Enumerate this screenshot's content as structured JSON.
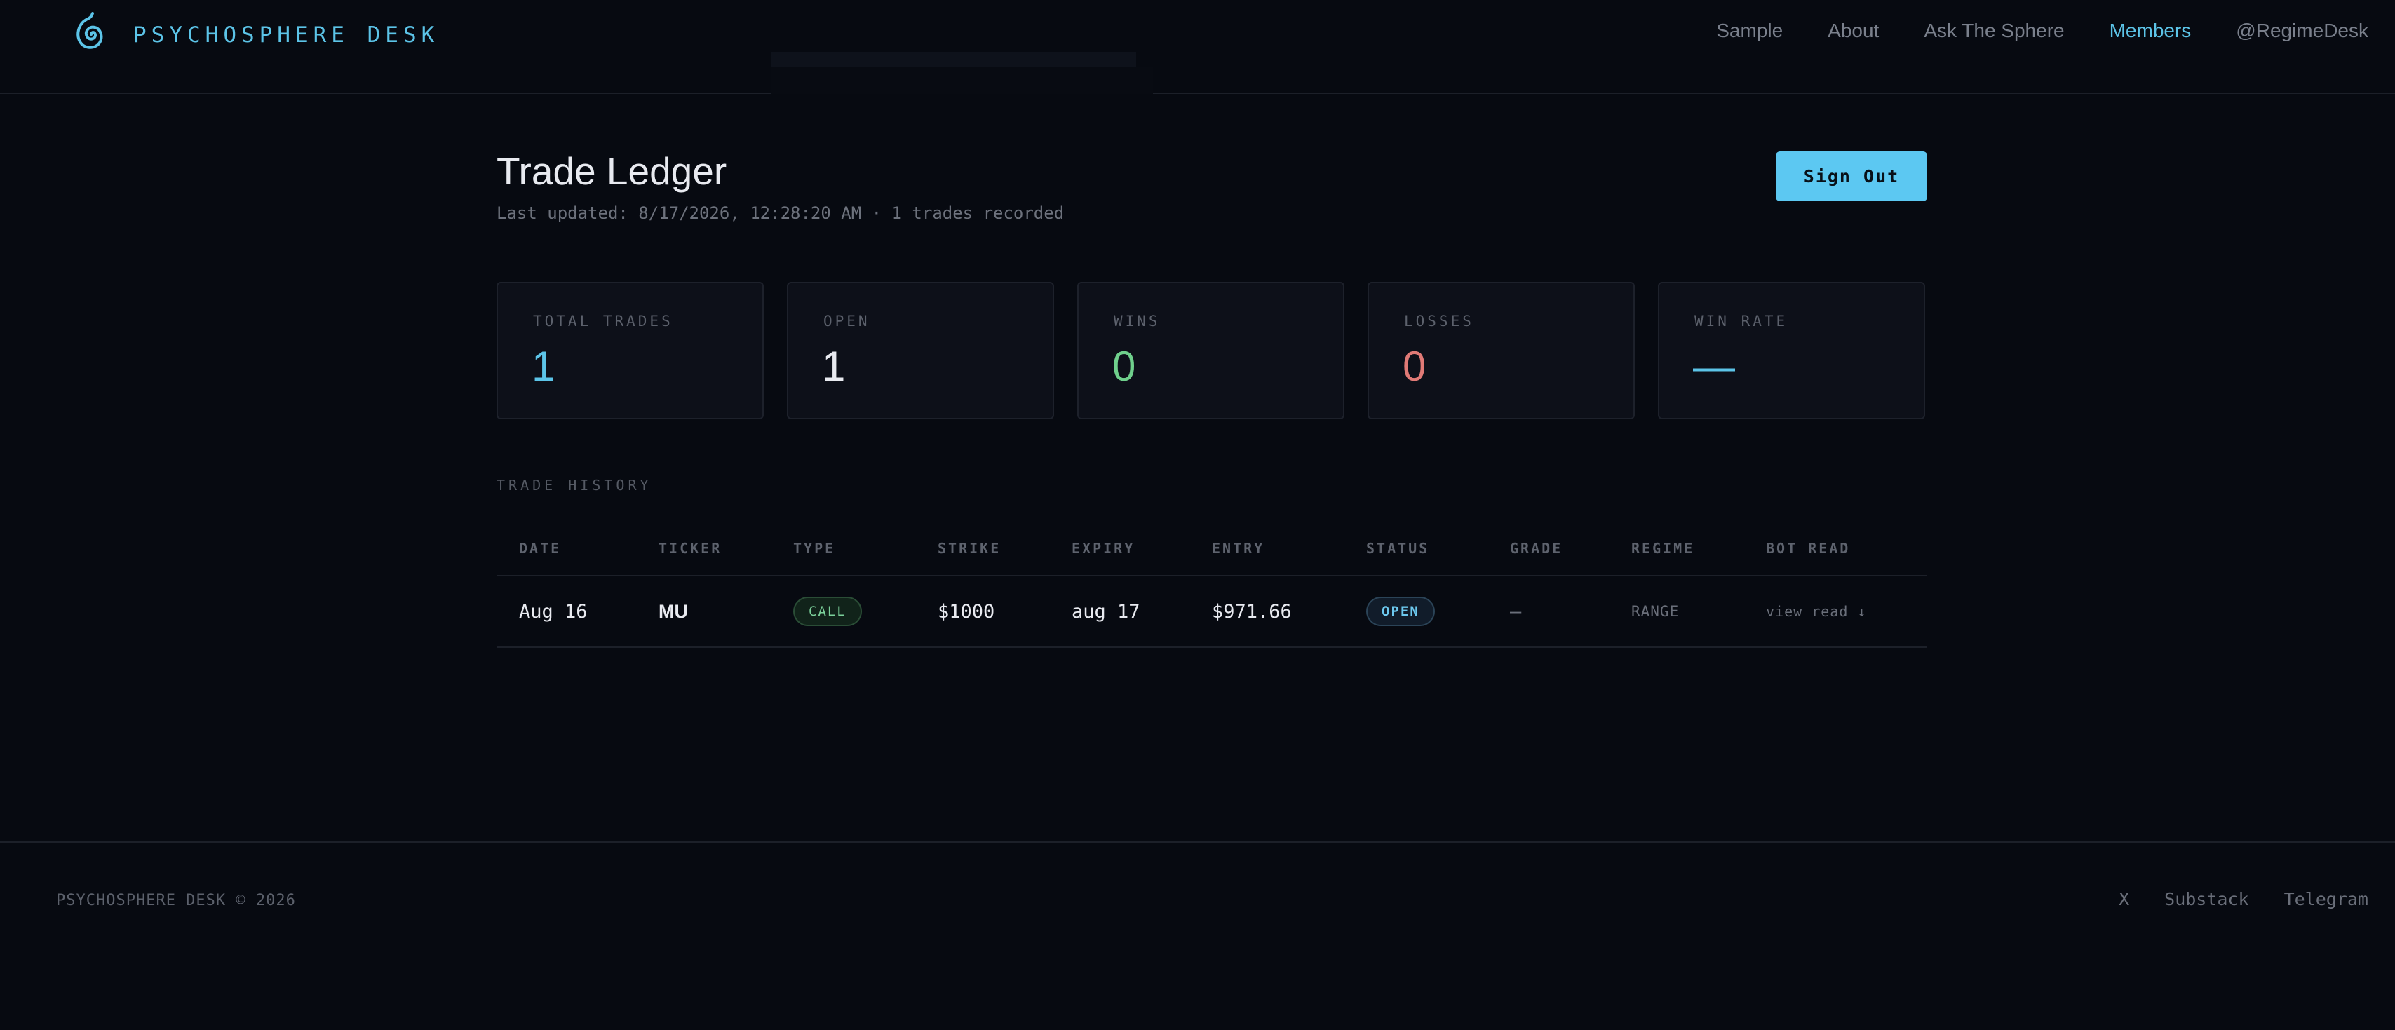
{
  "brand": {
    "name": "PSYCHOSPHERE DESK",
    "logo_icon": "spiral-icon",
    "accent": "#5cc4e8"
  },
  "nav": {
    "items": [
      "Sample",
      "About",
      "Ask The Sphere",
      "Members",
      "@RegimeDesk"
    ],
    "active": "Members"
  },
  "page": {
    "title": "Trade Ledger",
    "subtitle": "Last updated: 8/17/2026, 12:28:20 AM · 1 trades recorded",
    "signout_label": "Sign Out"
  },
  "stats": [
    {
      "label": "TOTAL TRADES",
      "value": "1",
      "color": "#5cc4e8"
    },
    {
      "label": "OPEN",
      "value": "1",
      "color": "#e8eaf0"
    },
    {
      "label": "WINS",
      "value": "0",
      "color": "#6fd08c"
    },
    {
      "label": "LOSSES",
      "value": "0",
      "color": "#e07a76"
    },
    {
      "label": "WIN RATE",
      "value": "—",
      "color": "#5cc4e8"
    }
  ],
  "history": {
    "label": "TRADE HISTORY",
    "columns": [
      "DATE",
      "TICKER",
      "TYPE",
      "STRIKE",
      "EXPIRY",
      "ENTRY",
      "STATUS",
      "GRADE",
      "REGIME",
      "BOT READ"
    ],
    "rows": [
      {
        "date": "Aug 16",
        "ticker": "MU",
        "type": "CALL",
        "strike": "$1000",
        "expiry": "aug 17",
        "entry": "$971.66",
        "status": "OPEN",
        "grade": "—",
        "regime": "RANGE",
        "bot_read": "view read ↓"
      }
    ]
  },
  "footer": {
    "copyright": "PSYCHOSPHERE DESK © 2026",
    "links": [
      "X",
      "Substack",
      "Telegram"
    ]
  }
}
